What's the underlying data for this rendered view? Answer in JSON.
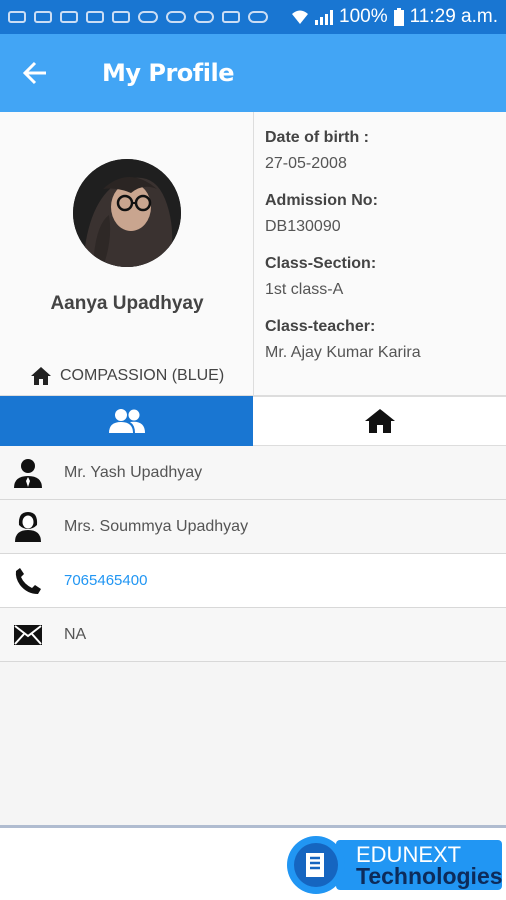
{
  "status_bar": {
    "battery": "100%",
    "time": "11:29 a.m."
  },
  "app_bar": {
    "title": "My Profile"
  },
  "profile": {
    "name": "Aanya Upadhyay",
    "house": "COMPASSION (BLUE)",
    "fields": [
      {
        "label": "Date of birth :",
        "value": "27-05-2008"
      },
      {
        "label": "Admission No:",
        "value": "DB130090"
      },
      {
        "label": "Class-Section:",
        "value": "1st class-A"
      },
      {
        "label": "Class-teacher:",
        "value": "Mr. Ajay Kumar Karira"
      }
    ]
  },
  "tabs": [
    {
      "icon": "people-icon",
      "active": true
    },
    {
      "icon": "home-icon",
      "active": false
    }
  ],
  "contacts": {
    "father": "Mr. Yash  Upadhyay",
    "mother": "Mrs. Soummya  Upadhyay",
    "phone": "7065465400",
    "email": "NA"
  },
  "footer": {
    "logo_line1": "EDUNEXT",
    "logo_line2": "Technologies"
  },
  "colors": {
    "status_bar": "#1976d2",
    "app_bar": "#42a5f5",
    "active_tab": "#1976d2",
    "link": "#2196f3"
  }
}
